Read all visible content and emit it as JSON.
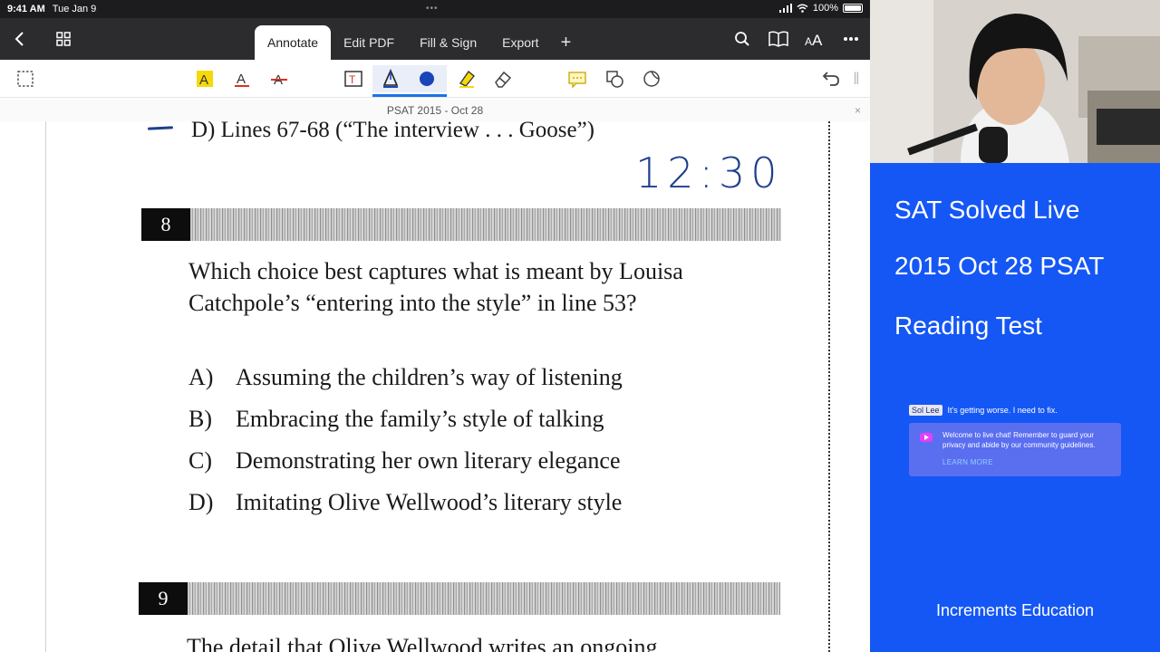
{
  "status_bar": {
    "time": "9:41 AM",
    "date": "Tue Jan 9",
    "battery": "100%"
  },
  "nav": {
    "tabs": [
      "Annotate",
      "Edit PDF",
      "Fill & Sign",
      "Export",
      "+"
    ],
    "active_tab": "Annotate"
  },
  "toolbar": {
    "icons": [
      "select-icon",
      "highlight-text-icon",
      "underline-text-icon",
      "strikethrough-text-icon",
      "text-box-icon",
      "pen-icon",
      "color-dot-icon",
      "highlighter-icon",
      "eraser-icon",
      "comment-icon",
      "shapes-icon",
      "lasso-icon",
      "undo-icon"
    ],
    "pen_color": "#1846b8",
    "highlight_color": "#f5d90a",
    "accent": "#1a73e8"
  },
  "document": {
    "title": "PSAT 2015 - Oct 28",
    "prev_option": "D)  Lines 67-68 (“The interview . . . Goose”)",
    "handwritten_time": "12:30",
    "q8": {
      "number": "8",
      "stem": "Which choice best captures what is meant by Louisa Catchpole’s “entering into the style” in line 53?",
      "options": [
        {
          "letter": "A)",
          "text": "Assuming the children’s way of listening"
        },
        {
          "letter": "B)",
          "text": "Embracing the family’s style of talking"
        },
        {
          "letter": "C)",
          "text": "Demonstrating her own literary elegance"
        },
        {
          "letter": "D)",
          "text": "Imitating Olive Wellwood’s literary style"
        }
      ]
    },
    "q9": {
      "number": "9",
      "stem_partial": "The detail that Olive Wellwood writes an ongoing"
    }
  },
  "sidebar": {
    "title1": "SAT Solved Live",
    "title2": "2015 Oct 28 PSAT",
    "title3": "Reading Test",
    "bg_color": "#1557f5",
    "chat": {
      "author": "Sol Lee",
      "message": "It's getting worse. I need to fix.",
      "welcome": "Welcome to live chat! Remember to guard your privacy and abide by our community guidelines.",
      "learn_more": "LEARN MORE"
    },
    "footer": "Increments Education"
  }
}
